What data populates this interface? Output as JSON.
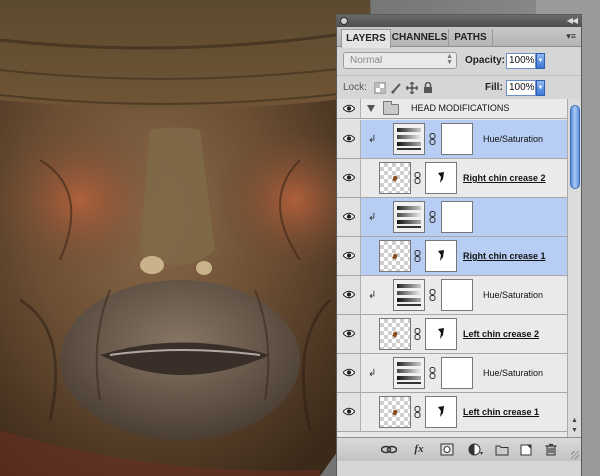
{
  "panel": {
    "tabs": [
      {
        "label": "LAYERS",
        "active": true
      },
      {
        "label": "CHANNELS",
        "active": false
      },
      {
        "label": "PATHS",
        "active": false
      }
    ],
    "tab_menu_icon": "panel-menu-icon",
    "blend_mode": "Normal",
    "opacity_label": "Opacity:",
    "opacity_value": "100%",
    "lock_label": "Lock:",
    "fill_label": "Fill:",
    "fill_value": "100%",
    "lock_icons": [
      "lock-transparent-icon",
      "lock-image-icon",
      "lock-position-icon",
      "lock-all-icon"
    ]
  },
  "group": {
    "name": "HEAD MODIFICATIONS",
    "icon": "folder-icon"
  },
  "layers": [
    {
      "name": "Hue/Saturation",
      "type": "adjustment",
      "selected": true
    },
    {
      "name": "Right chin crease 2",
      "type": "pixel",
      "selected": false
    },
    {
      "name": "",
      "type": "adjustment",
      "selected": true
    },
    {
      "name": "Right chin crease 1",
      "type": "pixel",
      "selected": true
    },
    {
      "name": "Hue/Saturation",
      "type": "adjustment",
      "selected": false
    },
    {
      "name": "Left chin crease 2",
      "type": "pixel",
      "selected": false
    },
    {
      "name": "Hue/Saturation",
      "type": "adjustment",
      "selected": false
    },
    {
      "name": "Left chin crease 1",
      "type": "pixel",
      "selected": false
    }
  ],
  "bottom_toolbar": {
    "buttons": [
      "link-layers-icon",
      "fx-icon",
      "add-mask-icon",
      "adjustment-layer-icon",
      "new-group-icon",
      "new-layer-icon",
      "trash-icon"
    ],
    "fx_label": "fx"
  },
  "colors": {
    "selected_row": "#b7cdf3",
    "scroll_thumb": "#5d8fd9"
  }
}
